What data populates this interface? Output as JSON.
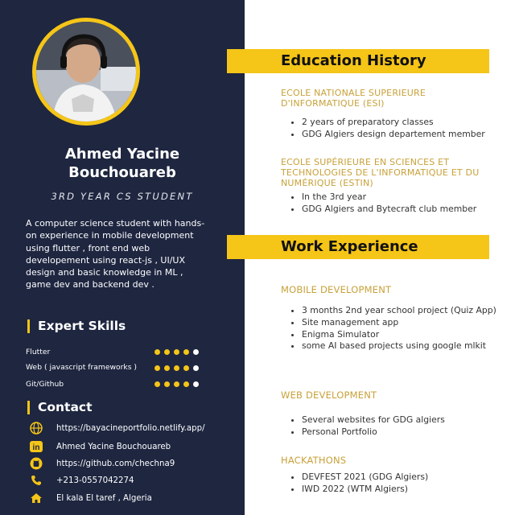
{
  "profile": {
    "name_line1": "Ahmed Yacine",
    "name_line2": "Bouchouareb",
    "role": "3RD YEAR CS STUDENT",
    "about": "A computer science student with hands-on experience in mobile development using flutter , front end web developement using react-js , UI/UX design and basic knowledge in ML , game dev and backend dev ."
  },
  "skills": {
    "heading": "Expert Skills",
    "items": [
      {
        "label": "Flutter",
        "level": 4,
        "max": 5
      },
      {
        "label": "Web ( javascript frameworks )",
        "level": 4,
        "max": 5
      },
      {
        "label": "Git/Github",
        "level": 4,
        "max": 5
      }
    ]
  },
  "contact": {
    "heading": "Contact",
    "items": [
      {
        "icon": "globe-icon",
        "text": "https://bayacineportfolio.netlify.app/"
      },
      {
        "icon": "linkedin-icon",
        "text": "Ahmed Yacine Bouchouareb"
      },
      {
        "icon": "github-icon",
        "text": "https://github.com/chechna9"
      },
      {
        "icon": "phone-icon",
        "text": "+213-0557042274"
      },
      {
        "icon": "home-icon",
        "text": "El kala El taref , Algeria"
      }
    ]
  },
  "education": {
    "heading": "Education History",
    "schools": [
      {
        "name": "ECOLE NATIONALE SUPERIEURE D'INFORMATIQUE (ESI)",
        "bullets": [
          "2 years of preparatory classes",
          "GDG Algiers design departement member"
        ]
      },
      {
        "name": "ECOLE SUPÉRIEURE EN SCIENCES ET TECHNOLOGIES DE L'INFORMATIQUE ET DU NUMÉRIQUE (ESTIN)",
        "bullets": [
          "In the 3rd year",
          "GDG Algiers and Bytecraft club member"
        ]
      }
    ]
  },
  "work": {
    "heading": "Work Experience",
    "sections": [
      {
        "title": "MOBILE DEVELOPMENT",
        "bullets": [
          "3 months 2nd year school project (Quiz App)",
          "Site management app",
          "Enigma Simulator",
          "some AI based projects using google mlkit"
        ]
      },
      {
        "title": "WEB DEVELOPMENT",
        "bullets": [
          "Several websites for GDG algiers",
          "Personal Portfolio"
        ]
      },
      {
        "title": "HACKATHONS",
        "bullets": [
          "DEVFEST 2021 (GDG Algiers)",
          "IWD 2022 (WTM Algiers)"
        ]
      }
    ]
  },
  "colors": {
    "accent": "#f5c518",
    "sidebar": "#1e2640",
    "subheading": "#c8a13a"
  }
}
